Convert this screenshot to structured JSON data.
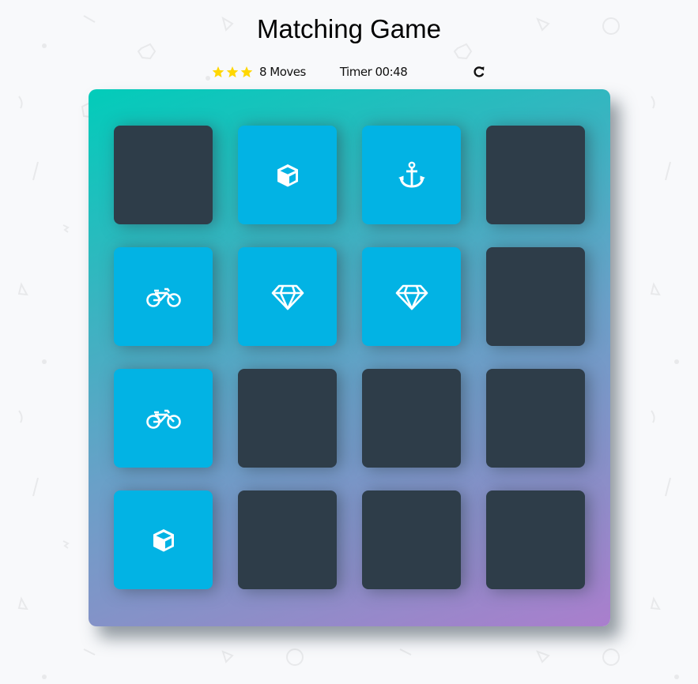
{
  "title": "Matching Game",
  "score_panel": {
    "stars": 3,
    "moves_label": "8 Moves",
    "timer_label": "Timer 00:48",
    "restart_icon": "redo-icon"
  },
  "colors": {
    "card_closed": "#2e3d49",
    "card_open": "#02b3e4",
    "star": "#ffd700",
    "deck_gradient_start": "#02ccba",
    "deck_gradient_end": "#aa7ecd"
  },
  "deck": {
    "cards": [
      {
        "state": "closed",
        "icon": ""
      },
      {
        "state": "open",
        "icon": "cube"
      },
      {
        "state": "open",
        "icon": "anchor"
      },
      {
        "state": "closed",
        "icon": ""
      },
      {
        "state": "open",
        "icon": "bicycle"
      },
      {
        "state": "open",
        "icon": "diamond"
      },
      {
        "state": "open",
        "icon": "diamond"
      },
      {
        "state": "closed",
        "icon": ""
      },
      {
        "state": "open",
        "icon": "bicycle"
      },
      {
        "state": "closed",
        "icon": ""
      },
      {
        "state": "closed",
        "icon": ""
      },
      {
        "state": "closed",
        "icon": ""
      },
      {
        "state": "open",
        "icon": "cube"
      },
      {
        "state": "closed",
        "icon": ""
      },
      {
        "state": "closed",
        "icon": ""
      },
      {
        "state": "closed",
        "icon": ""
      }
    ]
  }
}
